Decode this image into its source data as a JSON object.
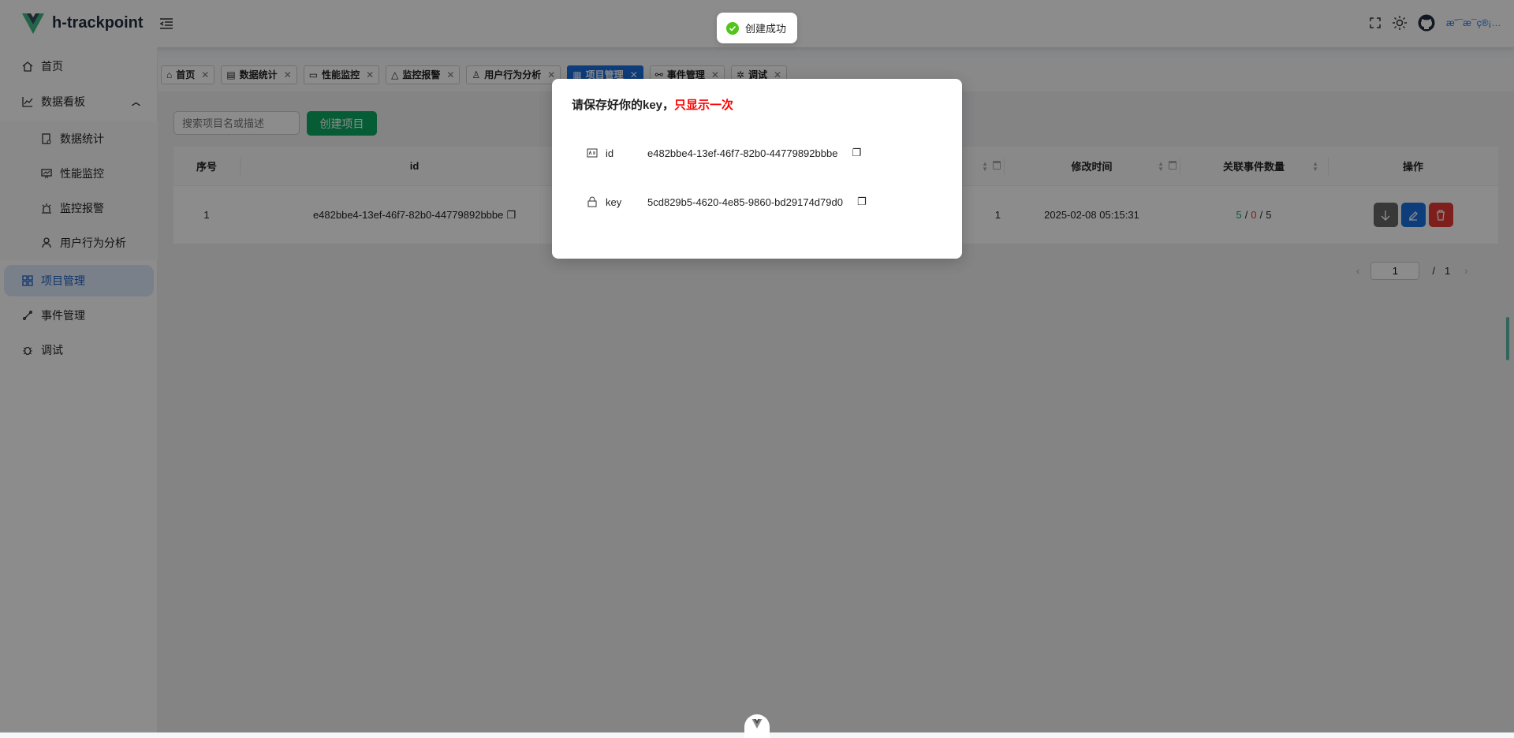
{
  "header": {
    "brand": "h-trackpoint",
    "user_link": "æ˜¯æ¯ç®¡…"
  },
  "sidebar": {
    "items": [
      {
        "label": "首页"
      },
      {
        "label": "数据看板"
      },
      {
        "label": "数据统计"
      },
      {
        "label": "性能监控"
      },
      {
        "label": "监控报警"
      },
      {
        "label": "用户行为分析"
      },
      {
        "label": "项目管理"
      },
      {
        "label": "事件管理"
      },
      {
        "label": "调试"
      }
    ]
  },
  "tabs": [
    {
      "label": "首页"
    },
    {
      "label": "数据统计"
    },
    {
      "label": "性能监控"
    },
    {
      "label": "监控报警"
    },
    {
      "label": "用户行为分析"
    },
    {
      "label": "项目管理"
    },
    {
      "label": "事件管理"
    },
    {
      "label": "调试"
    }
  ],
  "toolbar": {
    "search_placeholder": "搜索项目名或描述",
    "create_label": "创建项目"
  },
  "table": {
    "headers": {
      "index": "序号",
      "id": "id",
      "updated": "修改时间",
      "event_count": "关联事件数量",
      "actions": "操作"
    },
    "rows": [
      {
        "index": "1",
        "id": "e482bbe4-13ef-46f7-82b0-44779892bbbe",
        "hidden_tail": "1",
        "updated": "2025-02-08 05:15:31",
        "count_a": "5",
        "count_b": "0",
        "count_c": "5",
        "sep": "/"
      }
    ]
  },
  "pagination": {
    "current": "1",
    "sep": "/",
    "total": "1"
  },
  "modal": {
    "title": "请保存好你的key，",
    "title_warning": "只显示一次",
    "id_label": "id",
    "id_value": "e482bbe4-13ef-46f7-82b0-44779892bbbe",
    "key_label": "key",
    "key_value": "5cd829b5-4620-4e85-9860-bd29174d79d0"
  },
  "toast": {
    "message": "创建成功"
  },
  "colors": {
    "accent": "#1a6fe0",
    "success": "#0ba862",
    "danger": "#e53935"
  }
}
